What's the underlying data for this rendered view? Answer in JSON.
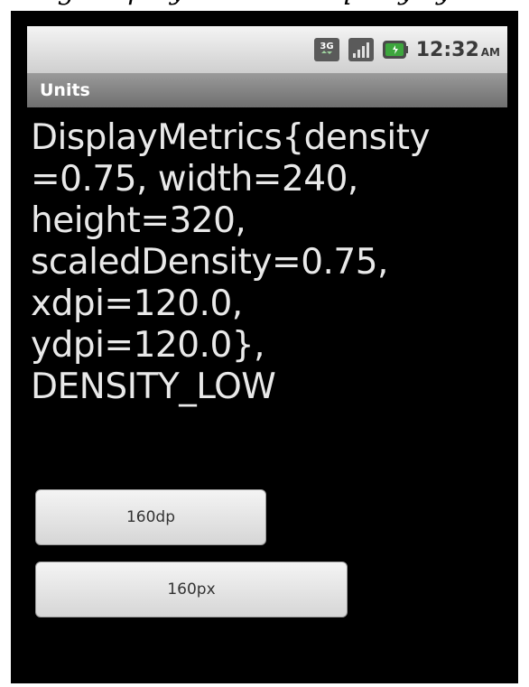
{
  "page_caption": "using DisplayMetrics to query system values",
  "status_bar": {
    "time": "12:32",
    "am_pm": "AM",
    "network_icon": "3g-icon",
    "signal_icon": "signal-bars-icon",
    "battery_icon": "battery-icon"
  },
  "title_bar": {
    "title": "Units"
  },
  "metrics": {
    "lines": [
      "DisplayMetrics{density",
      "=0.75, width=240,",
      "height=320,",
      "scaledDensity=0.75,",
      "xdpi=120.0,",
      "ydpi=120.0},",
      "DENSITY_LOW"
    ]
  },
  "buttons": {
    "dp_label": "160dp",
    "px_label": "160px"
  },
  "colors": {
    "screen_bg": "#000000",
    "text": "#e9e9e9",
    "status_bar": "#e6e6e6",
    "title_bar": "#808080",
    "button": "#e3e3e3",
    "battery_green": "#3da63d"
  }
}
